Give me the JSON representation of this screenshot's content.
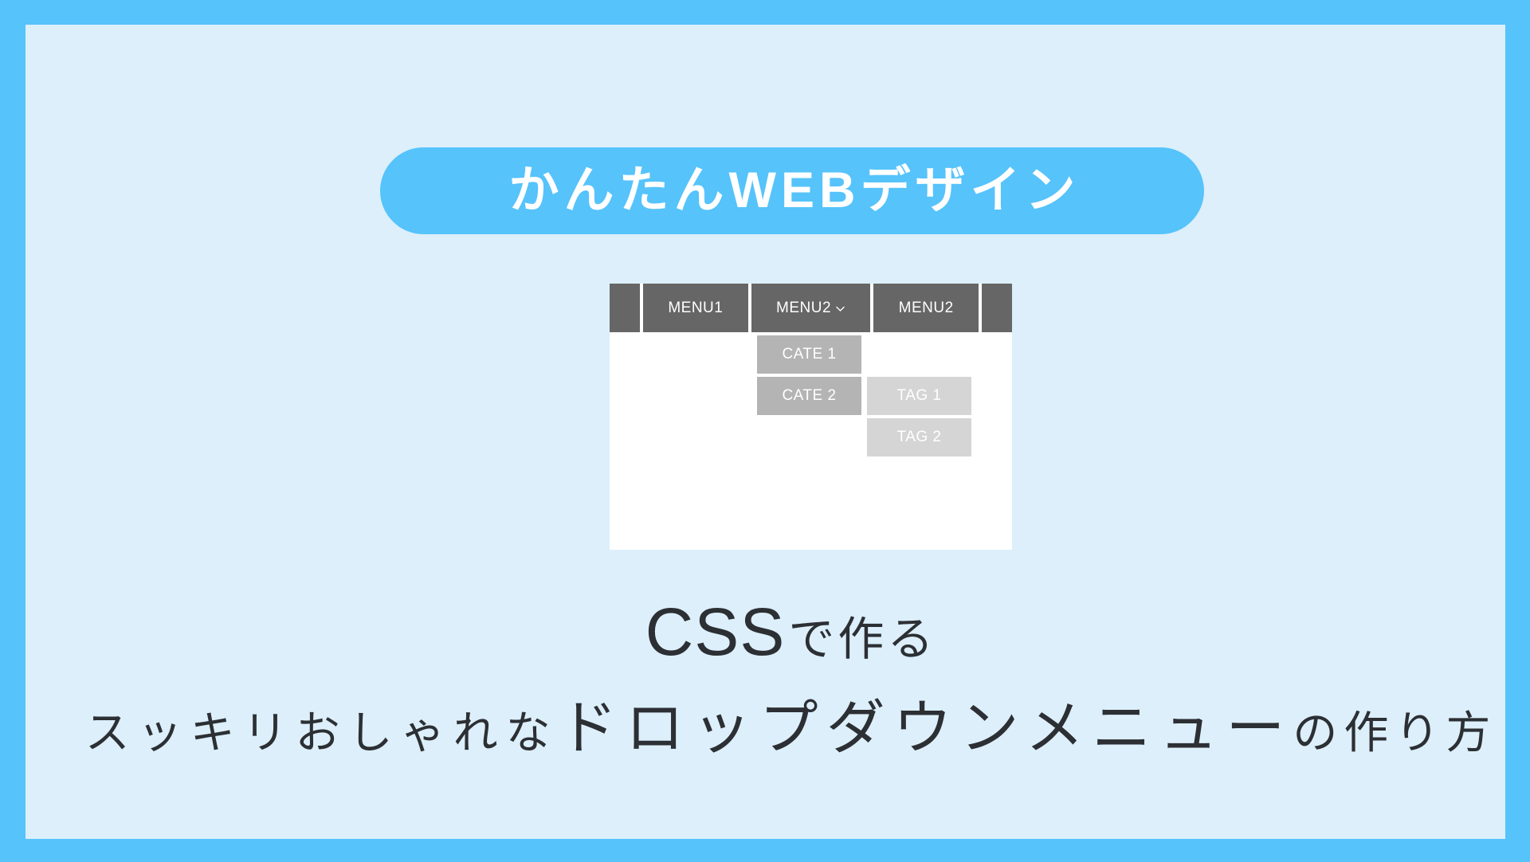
{
  "theme": {
    "frame_color": "#56c3fb",
    "panel_color": "#dceffb",
    "menu_bar_color": "#666666",
    "cate_color": "#b4b4b4",
    "tag_color": "#d5d5d5",
    "dropdown_panel_color": "#ffffff",
    "text_color": "#2c2f33",
    "menu_text_color": "#ffffff"
  },
  "banner": {
    "label": "かんたんWEBデザイン"
  },
  "menu_mock": {
    "bar": {
      "left_spacer": "",
      "items": [
        {
          "label": "MENU1",
          "has_chevron": false
        },
        {
          "label": "MENU2",
          "has_chevron": true,
          "chevron_icon": "chevron-down-icon"
        },
        {
          "label": "MENU2",
          "has_chevron": false
        }
      ],
      "right_spacer": ""
    },
    "categories": [
      {
        "label": "CATE 1"
      },
      {
        "label": "CATE 2"
      }
    ],
    "tags": [
      {
        "label": "TAG 1"
      },
      {
        "label": "TAG 2"
      }
    ]
  },
  "headline": {
    "line1_main": "CSS",
    "line1_suffix": "で作る",
    "line2_lead": "スッキリおしゃれな",
    "line2_emphasis": "ドロップダウンメニュー",
    "line2_tail": "の作り方"
  }
}
